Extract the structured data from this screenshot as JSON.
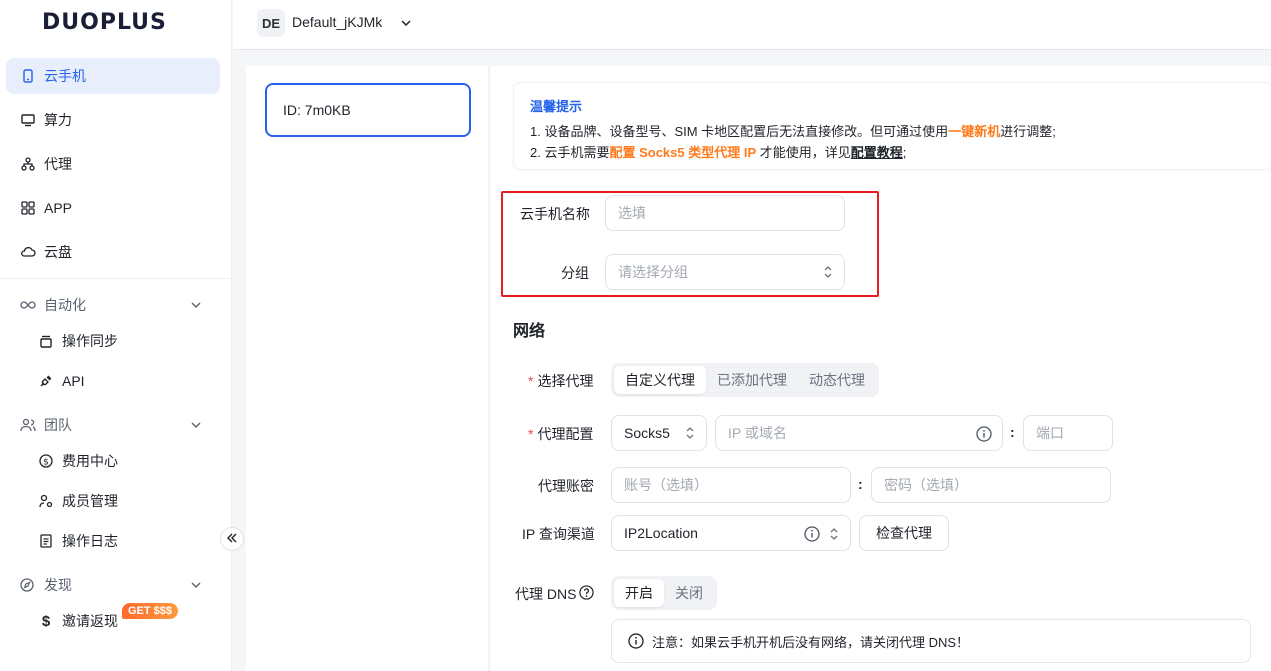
{
  "brand": {
    "logo_text": "DUOPLUS"
  },
  "workspace": {
    "avatar": "DE",
    "name": "Default_jKJMk"
  },
  "sidebar": {
    "items": [
      {
        "label": "云手机",
        "icon": "phone-icon",
        "active": true
      },
      {
        "label": "算力",
        "icon": "monitor-icon"
      },
      {
        "label": "代理",
        "icon": "network-icon"
      },
      {
        "label": "APP",
        "icon": "grid-icon"
      },
      {
        "label": "云盘",
        "icon": "cloud-icon"
      }
    ],
    "groups": [
      {
        "label": "自动化",
        "icon": "infinity-icon",
        "children": [
          {
            "label": "操作同步",
            "icon": "sync-icon"
          },
          {
            "label": "API",
            "icon": "plug-icon"
          }
        ]
      },
      {
        "label": "团队",
        "icon": "users-icon",
        "children": [
          {
            "label": "费用中心",
            "icon": "dollar-icon"
          },
          {
            "label": "成员管理",
            "icon": "user-manage-icon"
          },
          {
            "label": "操作日志",
            "icon": "log-icon"
          }
        ]
      },
      {
        "label": "发现",
        "icon": "compass-icon",
        "children": [
          {
            "label": "邀请返现",
            "icon": "dollar-sign-icon",
            "badge": "GET $$$"
          }
        ]
      }
    ]
  },
  "device": {
    "id_label": "ID: 7m0KB"
  },
  "tips": {
    "title": "温馨提示",
    "line1_pre": "1. 设备品牌、设备型号、SIM 卡地区配置后无法直接修改。但可通过使用",
    "line1_link": "一键新机",
    "line1_post": "进行调整;",
    "line2_pre": "2. 云手机需要",
    "line2_highlight": "配置 Socks5 类型代理 IP",
    "line2_mid": " 才能使用，详见",
    "line2_link": "配置教程",
    "line2_post": ";"
  },
  "form": {
    "name_label": "云手机名称",
    "name_placeholder": "选填",
    "group_label": "分组",
    "group_placeholder": "请选择分组",
    "network_title": "网络",
    "proxy_select_label": "选择代理",
    "proxy_tabs": [
      "自定义代理",
      "已添加代理",
      "动态代理"
    ],
    "proxy_config_label": "代理配置",
    "proxy_type": "Socks5",
    "ip_placeholder": "IP 或域名",
    "port_placeholder": "端口",
    "account_label": "代理账密",
    "account_placeholder": "账号（选填）",
    "password_placeholder": "密码（选填）",
    "ip_channel_label": "IP 查询渠道",
    "ip_channel_value": "IP2Location",
    "check_proxy_button": "检查代理",
    "dns_label": "代理 DNS",
    "dns_options": [
      "开启",
      "关闭"
    ],
    "dns_notice": "注意：如果云手机开机后没有网络，请关闭代理 DNS！"
  }
}
